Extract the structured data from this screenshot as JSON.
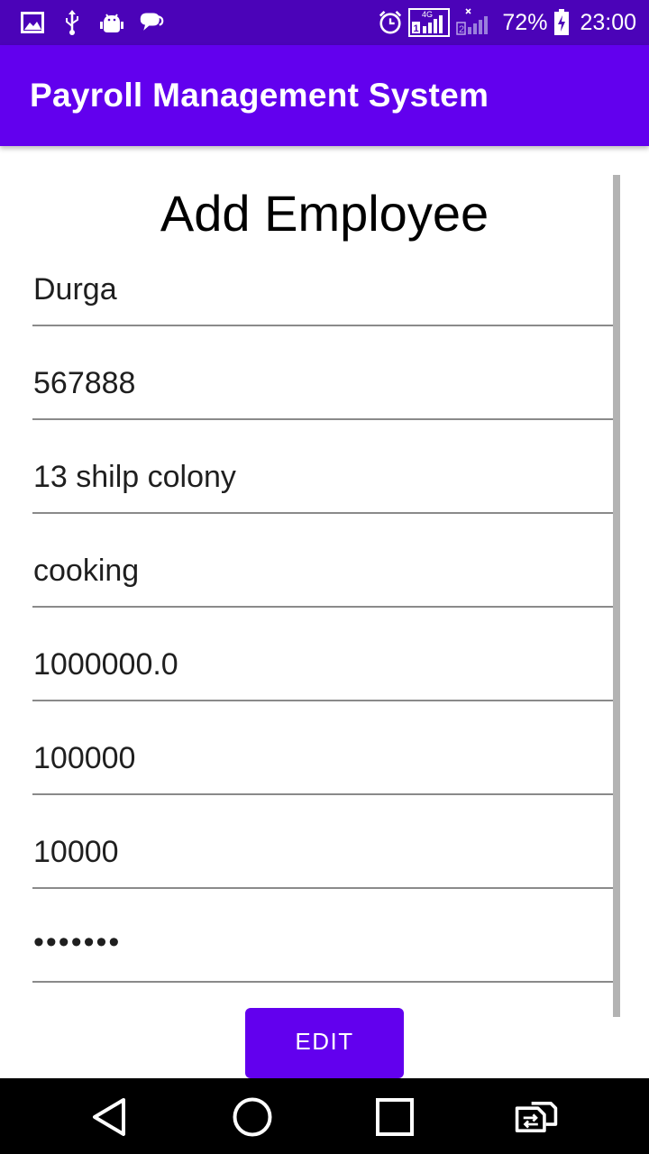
{
  "status_bar": {
    "network_badge": "4G",
    "battery_percent": "72%",
    "time": "23:00",
    "icons": [
      "gallery-icon",
      "usb-icon",
      "android-debug-icon",
      "chat-icon",
      "alarm-icon",
      "signal-sim1-icon",
      "signal-sim2-icon",
      "battery-charging-icon"
    ]
  },
  "app_bar": {
    "title": "Payroll Management System",
    "color": "#6200ee"
  },
  "form": {
    "heading": "Add Employee",
    "fields": [
      {
        "value": "Durga"
      },
      {
        "value": "567888"
      },
      {
        "value": "13 shilp colony"
      },
      {
        "value": "cooking"
      },
      {
        "value": "1000000.0"
      },
      {
        "value": "100000"
      },
      {
        "value": "10000"
      },
      {
        "value": "•••••••"
      }
    ],
    "edit_label": "EDIT"
  },
  "nav_bar": {
    "icons": [
      "back-icon",
      "home-icon",
      "recents-icon",
      "switch-sim-icon"
    ]
  }
}
